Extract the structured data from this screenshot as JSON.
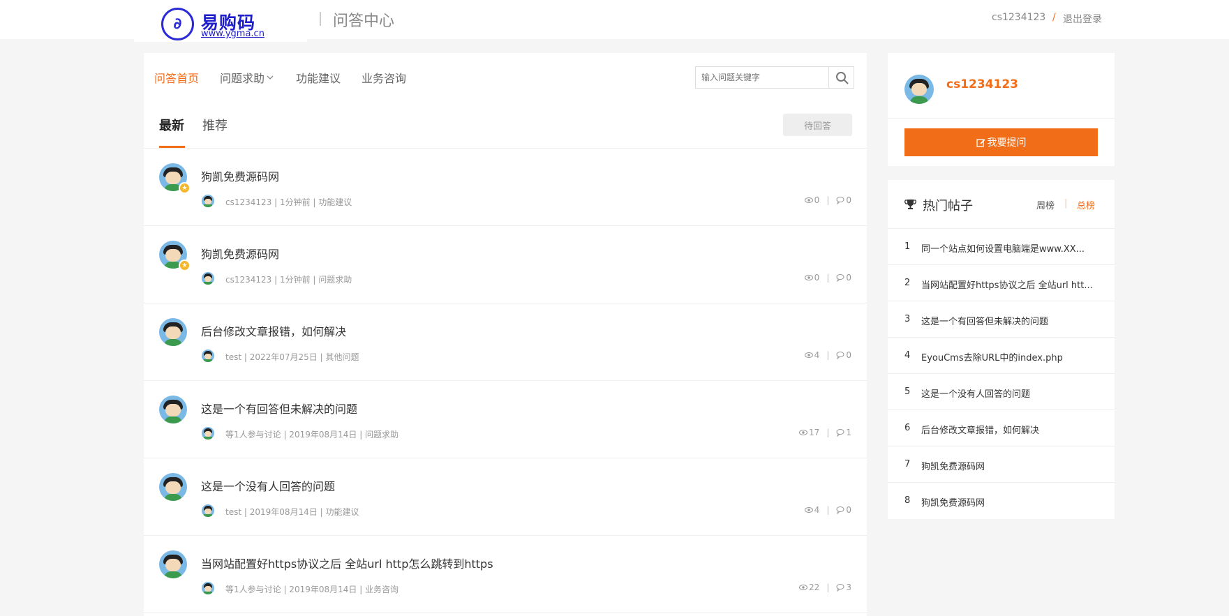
{
  "header": {
    "logo_text": "易购码",
    "logo_url": "www.ygma.cn",
    "section_title": "问答中心",
    "username": "cs1234123",
    "slash": "/",
    "logout": "退出登录"
  },
  "nav": {
    "items": [
      {
        "label": "问答首页",
        "active": true
      },
      {
        "label": "问题求助",
        "dropdown": true
      },
      {
        "label": "功能建议"
      },
      {
        "label": "业务咨询"
      }
    ],
    "search_placeholder": "输入问题关键字"
  },
  "tabs": {
    "items": [
      {
        "label": "最新",
        "active": true
      },
      {
        "label": "推荐"
      }
    ],
    "pending_label": "待回答"
  },
  "questions": [
    {
      "title": "狗凯免费源码网",
      "meta": "cs1234123 | 1分钟前 | 功能建议",
      "views": "0",
      "answers": "0",
      "badge": true
    },
    {
      "title": "狗凯免费源码网",
      "meta": "cs1234123 | 1分钟前 | 问题求助",
      "views": "0",
      "answers": "0",
      "badge": true
    },
    {
      "title": "后台修改文章报错，如何解决",
      "meta": "test | 2022年07月25日 | 其他问题",
      "views": "4",
      "answers": "0",
      "badge": false
    },
    {
      "title": "这是一个有回答但未解决的问题",
      "meta": "等1人参与讨论 | 2019年08月14日 | 问题求助",
      "views": "17",
      "answers": "1",
      "badge": false
    },
    {
      "title": "这是一个没有人回答的问题",
      "meta": "test | 2019年08月14日 | 功能建议",
      "views": "4",
      "answers": "0",
      "badge": false
    },
    {
      "title": "当网站配置好https协议之后 全站url http怎么跳转到https",
      "meta": "等1人参与讨论 | 2019年08月14日 | 业务咨询",
      "views": "22",
      "answers": "3",
      "badge": false
    }
  ],
  "user_card": {
    "name": "cs1234123",
    "ask_button": "我要提问"
  },
  "hot": {
    "title": "热门帖子",
    "week": "周榜",
    "sep": "|",
    "total": "总榜",
    "items": [
      {
        "num": "1",
        "text": "同一个站点如何设置电脑端是www.XX..."
      },
      {
        "num": "2",
        "text": "当网站配置好https协议之后 全站url htt..."
      },
      {
        "num": "3",
        "text": "这是一个有回答但未解决的问题"
      },
      {
        "num": "4",
        "text": "EyouCms去除URL中的index.php"
      },
      {
        "num": "5",
        "text": "这是一个没有人回答的问题"
      },
      {
        "num": "6",
        "text": "后台修改文章报错，如何解决"
      },
      {
        "num": "7",
        "text": "狗凯免费源码网"
      },
      {
        "num": "8",
        "text": "狗凯免费源码网"
      }
    ]
  },
  "colors": {
    "accent": "#f26d18",
    "logo": "#1e1ec8"
  },
  "icons": [
    "logo-icon",
    "search-icon",
    "chevron-down-icon",
    "eye-icon",
    "comment-icon",
    "edit-icon",
    "trophy-icon",
    "medal-badge-icon"
  ]
}
